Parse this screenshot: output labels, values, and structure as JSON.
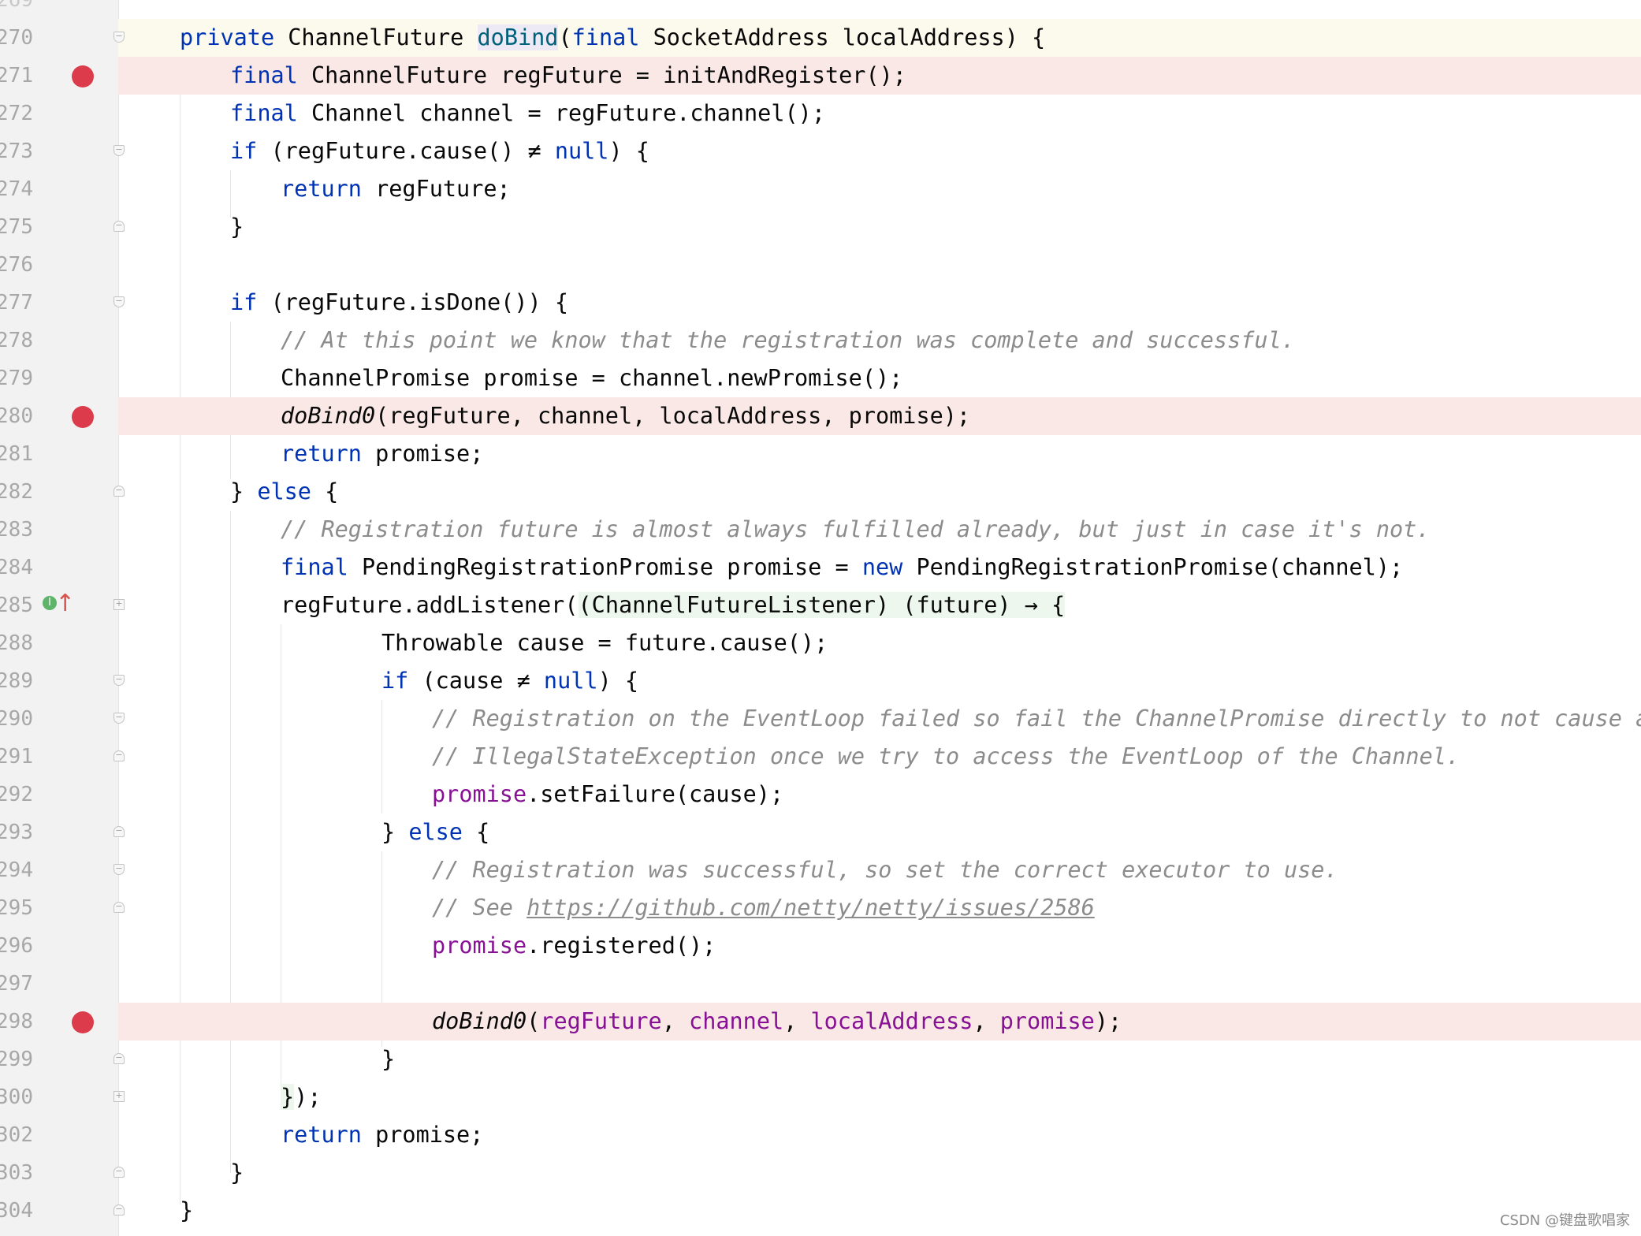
{
  "editor": {
    "line_numbers": [
      "270",
      "271",
      "272",
      "273",
      "274",
      "275",
      "276",
      "277",
      "278",
      "279",
      "280",
      "281",
      "282",
      "283",
      "284",
      "285",
      "288",
      "289",
      "290",
      "291",
      "292",
      "293",
      "294",
      "295",
      "296",
      "297",
      "298",
      "299",
      "300",
      "302",
      "303",
      "304"
    ],
    "lines": {
      "l270": {
        "kw": "private",
        "t1": " ChannelFuture ",
        "fn": "doBind",
        "t2": "(",
        "kw2": "final",
        "t3": " SocketAddress localAddress) {"
      },
      "l271": {
        "kw": "final",
        "t1": " ChannelFuture regFuture = initAndRegister();"
      },
      "l272": {
        "kw": "final",
        "t1": " Channel channel = regFuture.channel();"
      },
      "l273": {
        "kw": "if",
        "t1": " (regFuture.cause() ≠ ",
        "kw2": "null",
        "t2": ") {"
      },
      "l274": {
        "kw": "return",
        "t1": " regFuture;"
      },
      "l275": {
        "t1": "}"
      },
      "l277": {
        "kw": "if",
        "t1": " (regFuture.isDone()) {"
      },
      "l278": {
        "cmt": "// At this point we know that the registration was complete and successful."
      },
      "l279": {
        "t1": "ChannelPromise promise = channel.newPromise();"
      },
      "l280": {
        "it": "doBind0",
        "t1": "(regFuture, channel, localAddress, promise);"
      },
      "l281": {
        "kw": "return",
        "t1": " promise;"
      },
      "l282": {
        "t1": "} ",
        "kw": "else",
        "t2": " {"
      },
      "l283": {
        "cmt": "// Registration future is almost always fulfilled already, but just in case it's not."
      },
      "l284": {
        "kw": "final",
        "t1": " PendingRegistrationPromise promise = ",
        "kw2": "new",
        "t2": " PendingRegistrationPromise(channel);"
      },
      "l285": {
        "t1": "regFuture.addListener(",
        "lam": "(ChannelFutureListener) (future) → {"
      },
      "l288": {
        "t1": "Throwable cause = future.cause();"
      },
      "l289": {
        "kw": "if",
        "t1": " (cause ≠ ",
        "kw2": "null",
        "t2": ") {"
      },
      "l290": {
        "cmt": "// Registration on the EventLoop failed so fail the ChannelPromise directly to not cause an"
      },
      "l291": {
        "cmt": "// IllegalStateException once we try to access the EventLoop of the Channel."
      },
      "l292": {
        "p": "promise",
        "t1": ".setFailure(cause);"
      },
      "l293": {
        "t1": "} ",
        "kw": "else",
        "t2": " {"
      },
      "l294": {
        "cmt": "// Registration was successful, so set the correct executor to use."
      },
      "l295": {
        "cmt": "// See ",
        "link": "https://github.com/netty/netty/issues/2586"
      },
      "l296": {
        "p": "promise",
        "t1": ".registered();"
      },
      "l298": {
        "it": "doBind0",
        "t1": "(",
        "p1": "regFuture",
        "t2": ", ",
        "p2": "channel",
        "t3": ", ",
        "p3": "localAddress",
        "t4": ", ",
        "p4": "promise",
        "t5": ");"
      },
      "l299": {
        "t1": "}"
      },
      "l300": {
        "lam": "}",
        "t1": ");"
      },
      "l302": {
        "kw": "return",
        "t1": " promise;"
      },
      "l303": {
        "t1": "}"
      },
      "l304": {
        "t1": "}"
      }
    },
    "fold_glyph_open": "−",
    "fold_glyph_close": "−",
    "fold_glyph_collapsed": "+",
    "impl_badge": "I",
    "impl_arrow": "↑"
  },
  "watermark": "CSDN @键盘歌唱家",
  "colors": {
    "keyword": "#0033b3",
    "function": "#00627a",
    "comment": "#8c8c8c",
    "parameter": "#871094",
    "breakpoint": "#db3b4b",
    "breakpoint_line": "#f9e8e6",
    "current_line": "#fcfaed"
  },
  "breakpoint_lines": [
    "271",
    "280",
    "298"
  ]
}
